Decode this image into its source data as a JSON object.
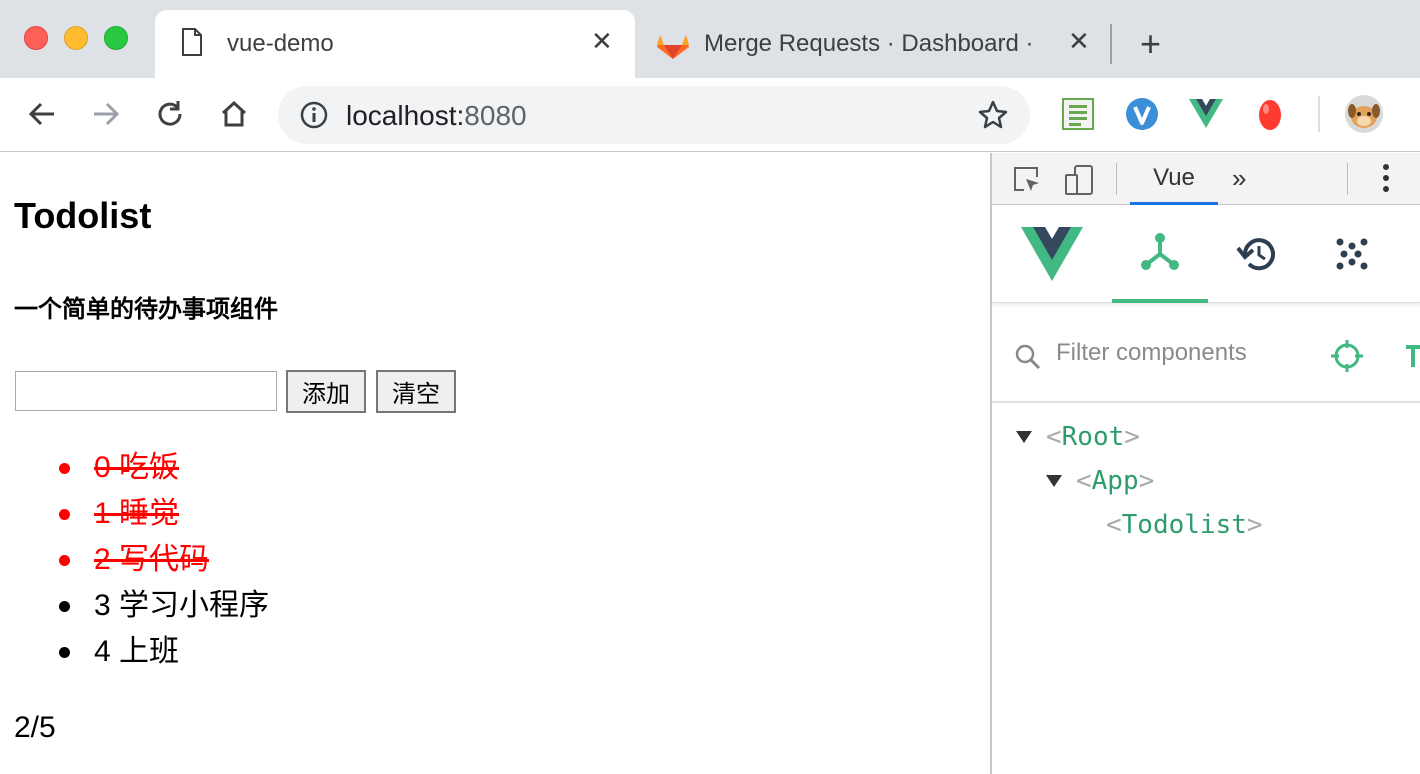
{
  "browser": {
    "tabs": [
      {
        "title": "vue-demo",
        "close": "✕"
      },
      {
        "title": "Merge Requests · Dashboard · GitLab",
        "close": "✕"
      }
    ],
    "new_tab": "+",
    "address": {
      "host": "localhost:",
      "port": "8080"
    }
  },
  "page": {
    "title": "Todolist",
    "subtitle": "一个简单的待办事项组件",
    "input_value": "",
    "add_label": "添加",
    "clear_label": "清空",
    "items": [
      {
        "text": "0 吃饭",
        "done": true
      },
      {
        "text": "1 睡觉",
        "done": true
      },
      {
        "text": "2 写代码",
        "done": true
      },
      {
        "text": "3 学习小程序",
        "done": false
      },
      {
        "text": "4 上班",
        "done": false
      }
    ],
    "counter": "2/5"
  },
  "devtools": {
    "active_panel": "Vue",
    "more": "»",
    "filter_placeholder": "Filter components",
    "tree": [
      {
        "open": "<",
        "name": "Root",
        "close": ">"
      },
      {
        "open": "<",
        "name": "App",
        "close": ">"
      },
      {
        "open": "<",
        "name": "Todolist",
        "close": ">"
      }
    ]
  },
  "colors": {
    "done": "#ff0000",
    "vue_green": "#42b983",
    "vue_dark": "#35495e",
    "tab_accent": "#1a73e8"
  }
}
